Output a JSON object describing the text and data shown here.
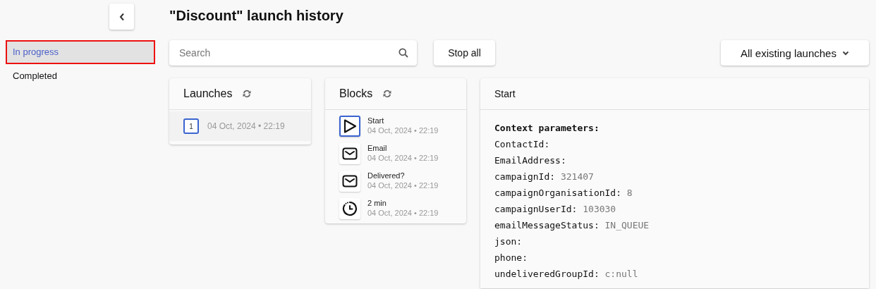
{
  "sidebar": {
    "items": [
      {
        "label": "In progress",
        "selected": true
      },
      {
        "label": "Completed",
        "selected": false
      }
    ]
  },
  "title": "\"Discount\" launch history",
  "search": {
    "placeholder": "Search"
  },
  "stop_button": "Stop all",
  "filter": {
    "value": "All existing launches"
  },
  "launches": {
    "title": "Launches",
    "items": [
      {
        "number": "1",
        "date": "04 Oct, 2024 • 22:19",
        "selected": true
      }
    ]
  },
  "blocks": {
    "title": "Blocks",
    "items": [
      {
        "kind": "start",
        "name": "Start",
        "date": "04 Oct, 2024 • 22:19",
        "selected": true
      },
      {
        "kind": "email",
        "name": "Email",
        "date": "04 Oct, 2024 • 22:19",
        "selected": false
      },
      {
        "kind": "email",
        "name": "Delivered?",
        "date": "04 Oct, 2024 • 22:19",
        "selected": false
      },
      {
        "kind": "timer",
        "name": "2 min",
        "date": "04 Oct, 2024 • 22:19",
        "selected": false
      }
    ]
  },
  "details": {
    "title": "Start",
    "heading": "Context parameters:",
    "params": [
      {
        "key": "ContactId:"
      },
      {
        "key": "EmailAddress:"
      },
      {
        "key": "campaignId:",
        "value": "321407"
      },
      {
        "key": "campaignOrganisationId:",
        "value": "8"
      },
      {
        "key": "campaignUserId:",
        "value": "103030"
      },
      {
        "key": "emailMessageStatus:",
        "value": "IN_QUEUE"
      },
      {
        "key": "json:"
      },
      {
        "key": "phone:"
      },
      {
        "key": "undeliveredGroupId:",
        "value": "c:null"
      }
    ]
  }
}
